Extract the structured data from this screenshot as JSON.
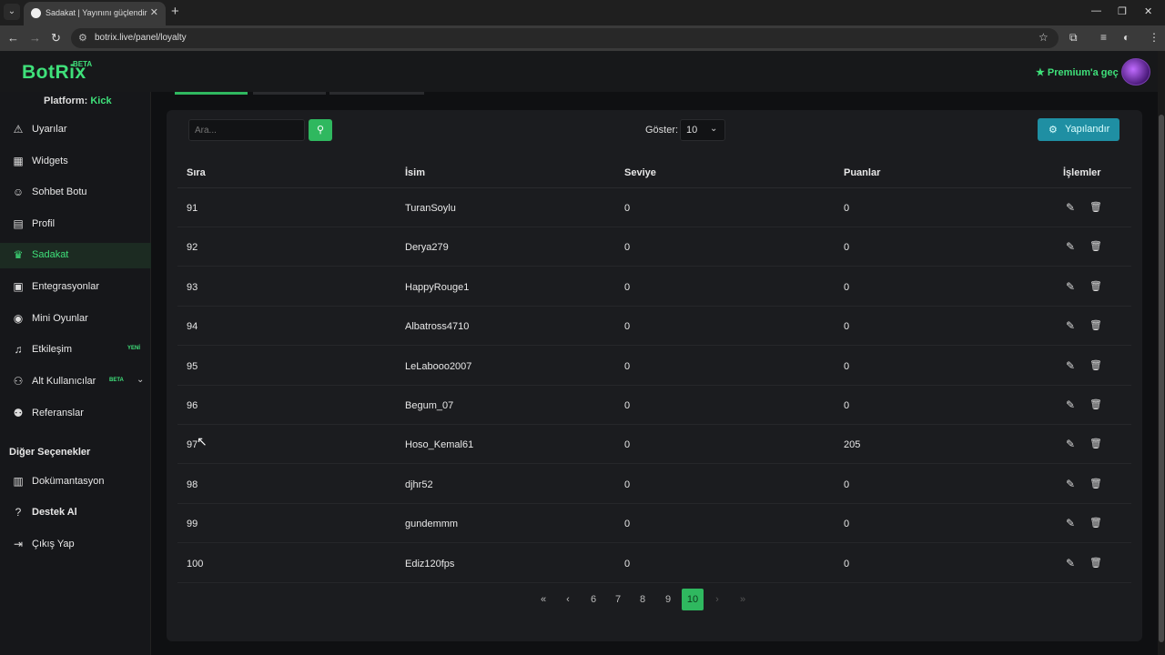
{
  "browser": {
    "tab_title": "Sadakat | Yayınını güçlendirmek",
    "url": "botrix.live/panel/loyalty",
    "icons": [
      "tab-list-icon",
      "close-icon",
      "plus-icon",
      "minimize-icon",
      "restore-icon",
      "close-window-icon",
      "back-icon",
      "forward-icon",
      "reload-icon",
      "site-info-icon",
      "star-icon",
      "extensions-icon",
      "media-icon",
      "profile-icon",
      "menu-icon"
    ]
  },
  "header": {
    "logo": "BotRix",
    "logo_badge": "BETA",
    "premium": "Premium'a geç"
  },
  "sidebar": {
    "platform_label": "Platform:",
    "platform_value": "Kick",
    "items": [
      {
        "label": "Uyarılar",
        "icon": "warning-icon"
      },
      {
        "label": "Widgets",
        "icon": "grid-icon"
      },
      {
        "label": "Sohbet Botu",
        "icon": "robot-icon"
      },
      {
        "label": "Profil",
        "icon": "id-card-icon"
      },
      {
        "label": "Sadakat",
        "icon": "trophy-icon"
      },
      {
        "label": "Entegrasyonlar",
        "icon": "integration-icon"
      },
      {
        "label": "Mini Oyunlar",
        "icon": "gamepad-icon"
      },
      {
        "label": "Etkileşim",
        "icon": "music-icon",
        "badge": "YENİ"
      },
      {
        "label": "Alt Kullanıcılar",
        "icon": "users-cog-icon",
        "badge": "BETA"
      },
      {
        "label": "Referanslar",
        "icon": "user-group-icon"
      }
    ],
    "other_title": "Diğer Seçenekler",
    "other_items": [
      {
        "label": "Dokümantasyon",
        "icon": "book-icon"
      },
      {
        "label": "Destek Al",
        "icon": "question-icon"
      },
      {
        "label": "Çıkış Yap",
        "icon": "logout-icon"
      }
    ]
  },
  "controls": {
    "search_placeholder": "Ara...",
    "show_label": "Göster:",
    "show_value": "10",
    "config_label": "Yapılandır"
  },
  "table": {
    "headers": [
      "Sıra",
      "İsim",
      "Seviye",
      "Puanlar",
      "İşlemler"
    ],
    "rows": [
      [
        "91",
        "TuranSoylu",
        "0",
        "0"
      ],
      [
        "92",
        "Derya279",
        "0",
        "0"
      ],
      [
        "93",
        "HappyRouge1",
        "0",
        "0"
      ],
      [
        "94",
        "Albatross4710",
        "0",
        "0"
      ],
      [
        "95",
        "LeLabooo2007",
        "0",
        "0"
      ],
      [
        "96",
        "Begum_07",
        "0",
        "0"
      ],
      [
        "97",
        "Hoso_Kemal61",
        "0",
        "205"
      ],
      [
        "98",
        "djhr52",
        "0",
        "0"
      ],
      [
        "99",
        "gundemmm",
        "0",
        "0"
      ],
      [
        "100",
        "Ediz120fps",
        "0",
        "0"
      ]
    ]
  },
  "pagination": {
    "pages": [
      "6",
      "7",
      "8",
      "9",
      "10"
    ],
    "current": "10"
  }
}
